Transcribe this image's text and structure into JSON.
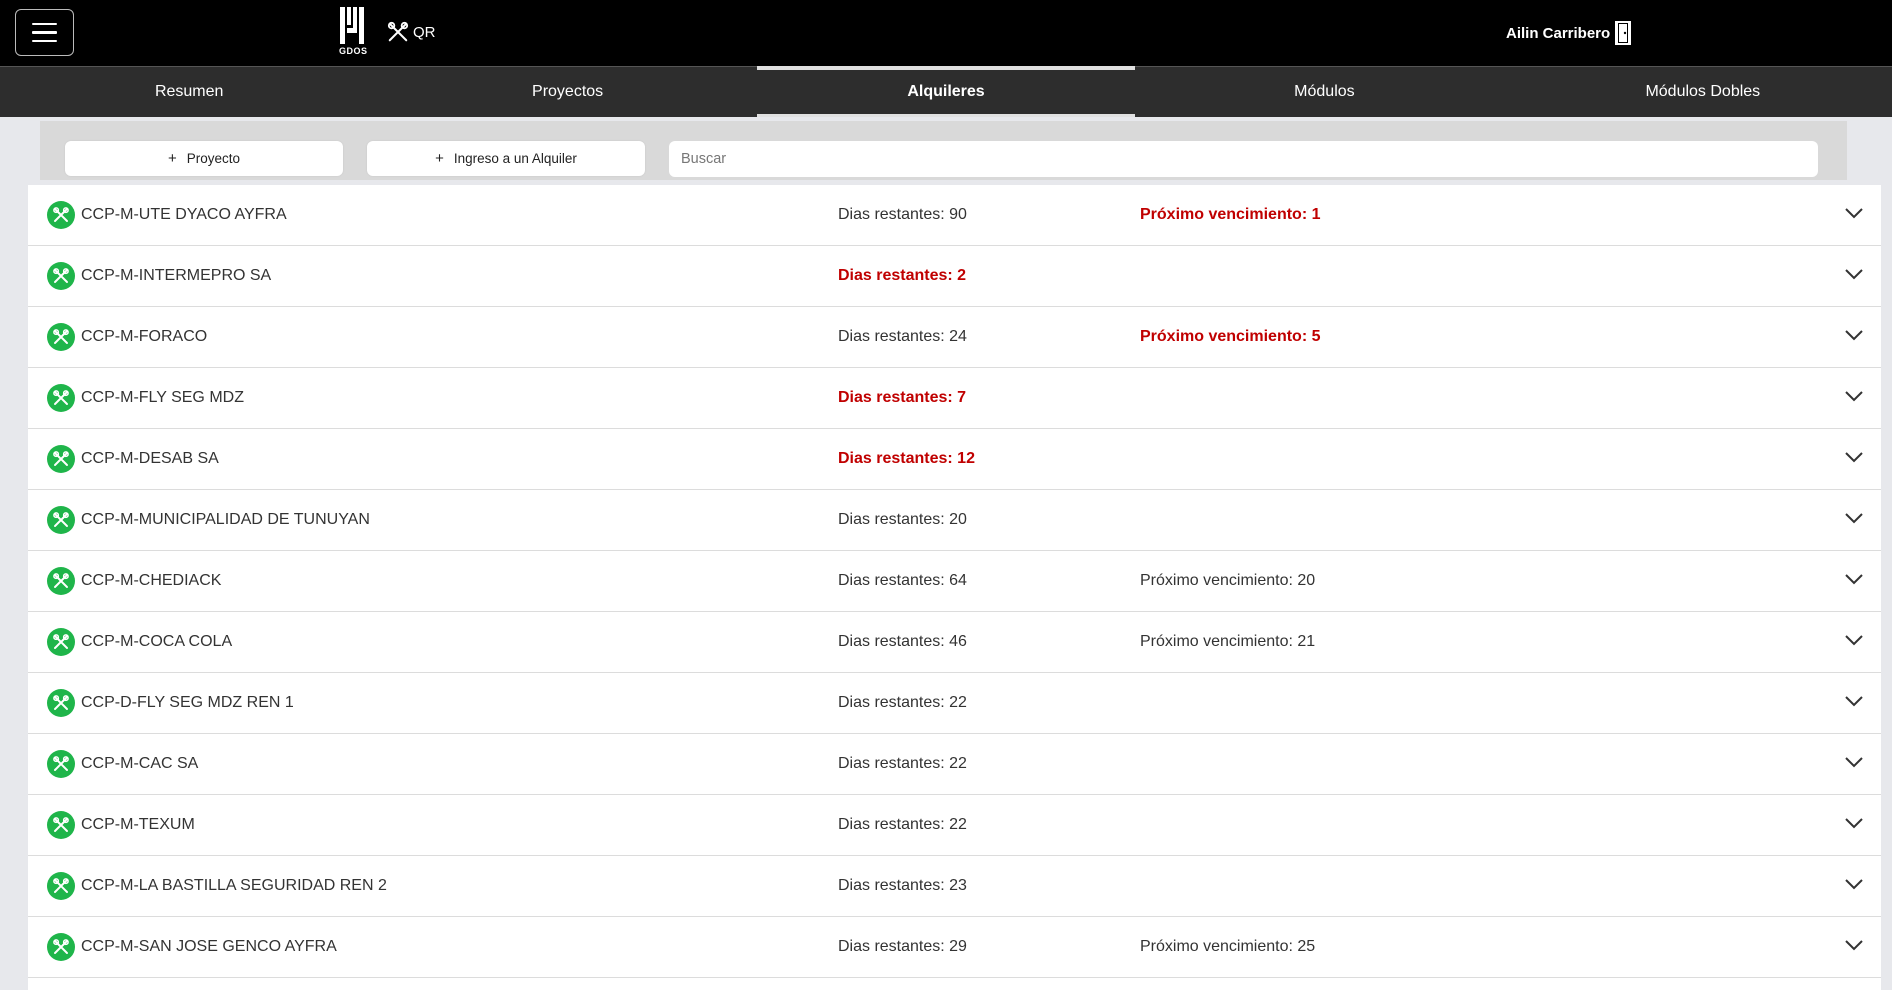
{
  "header": {
    "logo_text": "GDOS",
    "qr_label": "QR",
    "user_name": "Ailin Carribero",
    "icons": {
      "menu": "hamburger-menu-icon",
      "qr": "tools-icon",
      "user": "door-exit-icon"
    }
  },
  "tabs": [
    {
      "label": "Resumen",
      "active": false
    },
    {
      "label": "Proyectos",
      "active": false
    },
    {
      "label": "Alquileres",
      "active": true
    },
    {
      "label": "Módulos",
      "active": false
    },
    {
      "label": "Módulos Dobles",
      "active": false
    }
  ],
  "actions": {
    "add_project_label": "Proyecto",
    "add_rental_label": "Ingreso a un Alquiler",
    "search_placeholder": "Buscar",
    "search_value": ""
  },
  "colors": {
    "alert": "#c00000",
    "status_green": "#1fb54a",
    "header_bg": "#000000",
    "tabs_bg": "#2d2d2d"
  },
  "rentals": [
    {
      "name": "CCP-M-UTE DYACO AYFRA",
      "dias": "Dias restantes: 90",
      "dias_alert": false,
      "proximo": "Próximo vencimiento: 1",
      "proximo_alert": true
    },
    {
      "name": "CCP-M-INTERMEPRO SA",
      "dias": "Dias restantes: 2",
      "dias_alert": true,
      "proximo": "",
      "proximo_alert": false
    },
    {
      "name": "CCP-M-FORACO",
      "dias": "Dias restantes: 24",
      "dias_alert": false,
      "proximo": "Próximo vencimiento: 5",
      "proximo_alert": true
    },
    {
      "name": "CCP-M-FLY SEG MDZ",
      "dias": "Dias restantes: 7",
      "dias_alert": true,
      "proximo": "",
      "proximo_alert": false
    },
    {
      "name": "CCP-M-DESAB SA",
      "dias": "Dias restantes: 12",
      "dias_alert": true,
      "proximo": "",
      "proximo_alert": false
    },
    {
      "name": "CCP-M-MUNICIPALIDAD DE TUNUYAN",
      "dias": "Dias restantes: 20",
      "dias_alert": false,
      "proximo": "",
      "proximo_alert": false
    },
    {
      "name": "CCP-M-CHEDIACK",
      "dias": "Dias restantes: 64",
      "dias_alert": false,
      "proximo": "Próximo vencimiento: 20",
      "proximo_alert": false
    },
    {
      "name": "CCP-M-COCA COLA",
      "dias": "Dias restantes: 46",
      "dias_alert": false,
      "proximo": "Próximo vencimiento: 21",
      "proximo_alert": false
    },
    {
      "name": "CCP-D-FLY SEG MDZ REN 1",
      "dias": "Dias restantes: 22",
      "dias_alert": false,
      "proximo": "",
      "proximo_alert": false
    },
    {
      "name": "CCP-M-CAC SA",
      "dias": "Dias restantes: 22",
      "dias_alert": false,
      "proximo": "",
      "proximo_alert": false
    },
    {
      "name": "CCP-M-TEXUM",
      "dias": "Dias restantes: 22",
      "dias_alert": false,
      "proximo": "",
      "proximo_alert": false
    },
    {
      "name": "CCP-M-LA BASTILLA SEGURIDAD REN 2",
      "dias": "Dias restantes: 23",
      "dias_alert": false,
      "proximo": "",
      "proximo_alert": false
    },
    {
      "name": "CCP-M-SAN JOSE GENCO AYFRA",
      "dias": "Dias restantes: 29",
      "dias_alert": false,
      "proximo": "Próximo vencimiento: 25",
      "proximo_alert": false
    }
  ]
}
